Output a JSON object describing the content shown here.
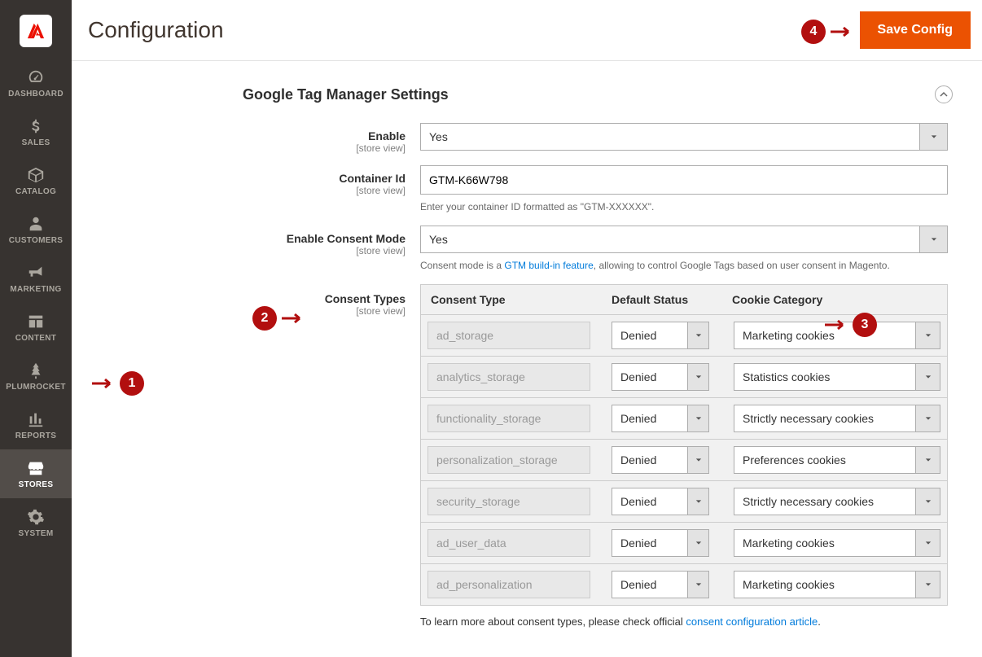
{
  "header": {
    "title": "Configuration",
    "save_button": "Save Config"
  },
  "sidebar": {
    "items": [
      {
        "label": "DASHBOARD",
        "icon": "dashboard"
      },
      {
        "label": "SALES",
        "icon": "dollar"
      },
      {
        "label": "CATALOG",
        "icon": "box"
      },
      {
        "label": "CUSTOMERS",
        "icon": "person"
      },
      {
        "label": "MARKETING",
        "icon": "megaphone"
      },
      {
        "label": "CONTENT",
        "icon": "layout"
      },
      {
        "label": "PLUMROCKET",
        "icon": "tree"
      },
      {
        "label": "REPORTS",
        "icon": "bars"
      },
      {
        "label": "STORES",
        "icon": "stores",
        "active": true
      },
      {
        "label": "SYSTEM",
        "icon": "gear"
      }
    ]
  },
  "section": {
    "title": "Google Tag Manager Settings"
  },
  "fields": {
    "enable": {
      "label": "Enable",
      "scope": "[store view]",
      "value": "Yes"
    },
    "container": {
      "label": "Container Id",
      "scope": "[store view]",
      "value": "GTM-K66W798",
      "help": "Enter your container ID formatted as \"GTM-XXXXXX\"."
    },
    "consent_mode": {
      "label": "Enable Consent Mode",
      "scope": "[store view]",
      "value": "Yes",
      "help_prefix": "Consent mode is a ",
      "help_link": "GTM build-in feature",
      "help_suffix": ", allowing to control Google Tags based on user consent in Magento."
    },
    "consent_types": {
      "label": "Consent Types",
      "scope": "[store view]"
    }
  },
  "consent_table": {
    "headers": {
      "type": "Consent Type",
      "status": "Default Status",
      "category": "Cookie Category"
    },
    "rows": [
      {
        "type": "ad_storage",
        "status": "Denied",
        "category": "Marketing cookies"
      },
      {
        "type": "analytics_storage",
        "status": "Denied",
        "category": "Statistics cookies"
      },
      {
        "type": "functionality_storage",
        "status": "Denied",
        "category": "Strictly necessary cookies"
      },
      {
        "type": "personalization_storage",
        "status": "Denied",
        "category": "Preferences cookies"
      },
      {
        "type": "security_storage",
        "status": "Denied",
        "category": "Strictly necessary cookies"
      },
      {
        "type": "ad_user_data",
        "status": "Denied",
        "category": "Marketing cookies"
      },
      {
        "type": "ad_personalization",
        "status": "Denied",
        "category": "Marketing cookies"
      }
    ],
    "footer_prefix": "To learn more about consent types, please check official ",
    "footer_link": "consent configuration article",
    "footer_suffix": "."
  },
  "markers": {
    "m1": "1",
    "m2": "2",
    "m3": "3",
    "m4": "4"
  }
}
